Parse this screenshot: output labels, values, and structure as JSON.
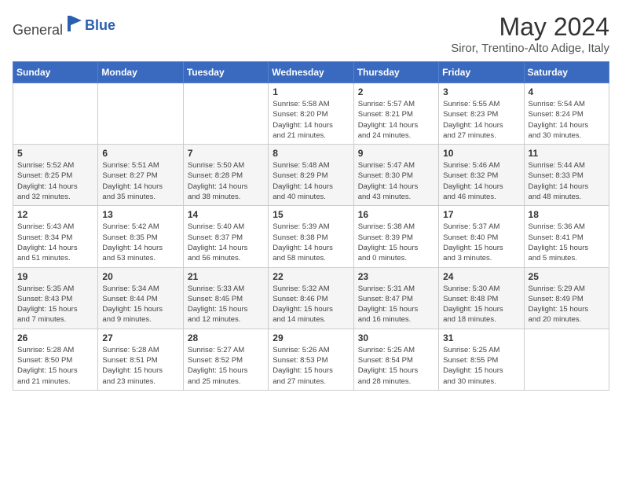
{
  "header": {
    "logo_general": "General",
    "logo_blue": "Blue",
    "title": "May 2024",
    "location": "Siror, Trentino-Alto Adige, Italy"
  },
  "weekdays": [
    "Sunday",
    "Monday",
    "Tuesday",
    "Wednesday",
    "Thursday",
    "Friday",
    "Saturday"
  ],
  "weeks": [
    [
      {
        "day": null,
        "info": ""
      },
      {
        "day": null,
        "info": ""
      },
      {
        "day": null,
        "info": ""
      },
      {
        "day": "1",
        "info": "Sunrise: 5:58 AM\nSunset: 8:20 PM\nDaylight: 14 hours\nand 21 minutes."
      },
      {
        "day": "2",
        "info": "Sunrise: 5:57 AM\nSunset: 8:21 PM\nDaylight: 14 hours\nand 24 minutes."
      },
      {
        "day": "3",
        "info": "Sunrise: 5:55 AM\nSunset: 8:23 PM\nDaylight: 14 hours\nand 27 minutes."
      },
      {
        "day": "4",
        "info": "Sunrise: 5:54 AM\nSunset: 8:24 PM\nDaylight: 14 hours\nand 30 minutes."
      }
    ],
    [
      {
        "day": "5",
        "info": "Sunrise: 5:52 AM\nSunset: 8:25 PM\nDaylight: 14 hours\nand 32 minutes."
      },
      {
        "day": "6",
        "info": "Sunrise: 5:51 AM\nSunset: 8:27 PM\nDaylight: 14 hours\nand 35 minutes."
      },
      {
        "day": "7",
        "info": "Sunrise: 5:50 AM\nSunset: 8:28 PM\nDaylight: 14 hours\nand 38 minutes."
      },
      {
        "day": "8",
        "info": "Sunrise: 5:48 AM\nSunset: 8:29 PM\nDaylight: 14 hours\nand 40 minutes."
      },
      {
        "day": "9",
        "info": "Sunrise: 5:47 AM\nSunset: 8:30 PM\nDaylight: 14 hours\nand 43 minutes."
      },
      {
        "day": "10",
        "info": "Sunrise: 5:46 AM\nSunset: 8:32 PM\nDaylight: 14 hours\nand 46 minutes."
      },
      {
        "day": "11",
        "info": "Sunrise: 5:44 AM\nSunset: 8:33 PM\nDaylight: 14 hours\nand 48 minutes."
      }
    ],
    [
      {
        "day": "12",
        "info": "Sunrise: 5:43 AM\nSunset: 8:34 PM\nDaylight: 14 hours\nand 51 minutes."
      },
      {
        "day": "13",
        "info": "Sunrise: 5:42 AM\nSunset: 8:35 PM\nDaylight: 14 hours\nand 53 minutes."
      },
      {
        "day": "14",
        "info": "Sunrise: 5:40 AM\nSunset: 8:37 PM\nDaylight: 14 hours\nand 56 minutes."
      },
      {
        "day": "15",
        "info": "Sunrise: 5:39 AM\nSunset: 8:38 PM\nDaylight: 14 hours\nand 58 minutes."
      },
      {
        "day": "16",
        "info": "Sunrise: 5:38 AM\nSunset: 8:39 PM\nDaylight: 15 hours\nand 0 minutes."
      },
      {
        "day": "17",
        "info": "Sunrise: 5:37 AM\nSunset: 8:40 PM\nDaylight: 15 hours\nand 3 minutes."
      },
      {
        "day": "18",
        "info": "Sunrise: 5:36 AM\nSunset: 8:41 PM\nDaylight: 15 hours\nand 5 minutes."
      }
    ],
    [
      {
        "day": "19",
        "info": "Sunrise: 5:35 AM\nSunset: 8:43 PM\nDaylight: 15 hours\nand 7 minutes."
      },
      {
        "day": "20",
        "info": "Sunrise: 5:34 AM\nSunset: 8:44 PM\nDaylight: 15 hours\nand 9 minutes."
      },
      {
        "day": "21",
        "info": "Sunrise: 5:33 AM\nSunset: 8:45 PM\nDaylight: 15 hours\nand 12 minutes."
      },
      {
        "day": "22",
        "info": "Sunrise: 5:32 AM\nSunset: 8:46 PM\nDaylight: 15 hours\nand 14 minutes."
      },
      {
        "day": "23",
        "info": "Sunrise: 5:31 AM\nSunset: 8:47 PM\nDaylight: 15 hours\nand 16 minutes."
      },
      {
        "day": "24",
        "info": "Sunrise: 5:30 AM\nSunset: 8:48 PM\nDaylight: 15 hours\nand 18 minutes."
      },
      {
        "day": "25",
        "info": "Sunrise: 5:29 AM\nSunset: 8:49 PM\nDaylight: 15 hours\nand 20 minutes."
      }
    ],
    [
      {
        "day": "26",
        "info": "Sunrise: 5:28 AM\nSunset: 8:50 PM\nDaylight: 15 hours\nand 21 minutes."
      },
      {
        "day": "27",
        "info": "Sunrise: 5:28 AM\nSunset: 8:51 PM\nDaylight: 15 hours\nand 23 minutes."
      },
      {
        "day": "28",
        "info": "Sunrise: 5:27 AM\nSunset: 8:52 PM\nDaylight: 15 hours\nand 25 minutes."
      },
      {
        "day": "29",
        "info": "Sunrise: 5:26 AM\nSunset: 8:53 PM\nDaylight: 15 hours\nand 27 minutes."
      },
      {
        "day": "30",
        "info": "Sunrise: 5:25 AM\nSunset: 8:54 PM\nDaylight: 15 hours\nand 28 minutes."
      },
      {
        "day": "31",
        "info": "Sunrise: 5:25 AM\nSunset: 8:55 PM\nDaylight: 15 hours\nand 30 minutes."
      },
      {
        "day": null,
        "info": ""
      }
    ]
  ]
}
